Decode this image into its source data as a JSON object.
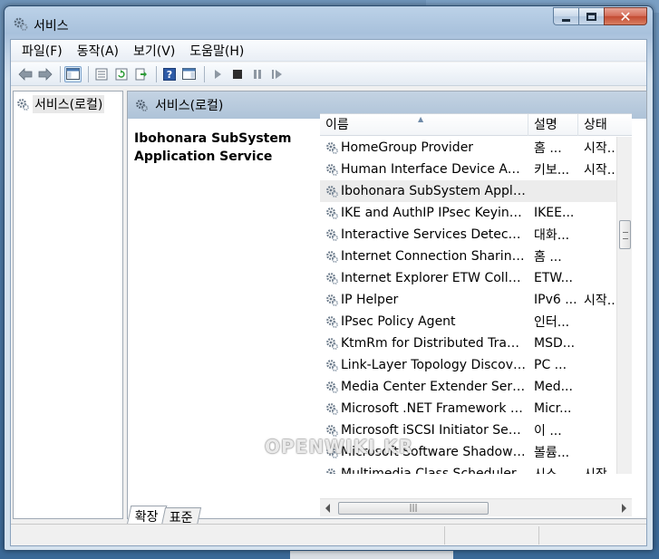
{
  "window": {
    "title": "서비스"
  },
  "menu": [
    "파일(F)",
    "동작(A)",
    "보기(V)",
    "도움말(H)"
  ],
  "tree": {
    "root_label": "서비스(로컬)"
  },
  "pane": {
    "header_label": "서비스(로컬)",
    "description_title": "Ibohonara SubSystem Application Service"
  },
  "list": {
    "columns": [
      "이름",
      "설명",
      "상태"
    ],
    "rows": [
      {
        "name": "HomeGroup Provider",
        "desc": "홈 ...",
        "status": "시작..."
      },
      {
        "name": "Human Interface Device Acc...",
        "desc": "키보...",
        "status": "시작..."
      },
      {
        "name": "Ibohonara SubSystem Appli...",
        "desc": "",
        "status": "",
        "selected": true
      },
      {
        "name": "IKE and AuthIP IPsec Keying...",
        "desc": "IKEE...",
        "status": ""
      },
      {
        "name": "Interactive Services Detection",
        "desc": "대화...",
        "status": ""
      },
      {
        "name": "Internet Connection Sharing...",
        "desc": "홈 ...",
        "status": ""
      },
      {
        "name": "Internet Explorer ETW Collec...",
        "desc": "ETW...",
        "status": ""
      },
      {
        "name": "IP Helper",
        "desc": "IPv6 ...",
        "status": "시작..."
      },
      {
        "name": "IPsec Policy Agent",
        "desc": "인터...",
        "status": ""
      },
      {
        "name": "KtmRm for Distributed Trans...",
        "desc": "MSD...",
        "status": ""
      },
      {
        "name": "Link-Layer Topology Discove...",
        "desc": "PC ...",
        "status": ""
      },
      {
        "name": "Media Center Extender Servi...",
        "desc": "Med...",
        "status": ""
      },
      {
        "name": "Microsoft .NET Framework N...",
        "desc": "Micr...",
        "status": ""
      },
      {
        "name": "Microsoft iSCSI Initiator Serv...",
        "desc": "이 ...",
        "status": ""
      },
      {
        "name": "Microsoft Software Shadow ...",
        "desc": "볼륨...",
        "status": ""
      },
      {
        "name": "Multimedia Class Scheduler",
        "desc": "시스...",
        "status": "시작..."
      }
    ]
  },
  "tabs": [
    "확장",
    "표준"
  ],
  "watermark": "OPENWIKI.KR",
  "colors": {
    "selection": "#ececec",
    "header": "#aec3d8",
    "title_close": "#c34a31"
  }
}
